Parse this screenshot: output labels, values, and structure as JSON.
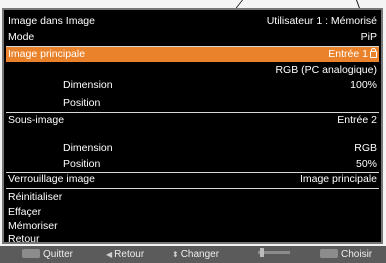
{
  "menu": {
    "title": "Image dans Image",
    "user_status": "Utilisateur 1 : Mémorisé",
    "mode_label": "Mode",
    "mode_value": "PiP",
    "main_image_label": "Image principale",
    "main_image_value": "Entrée 1",
    "main_image_signal": "RGB (PC analogique)",
    "main_dimension_label": "Dimension",
    "main_dimension_value": "100%",
    "main_position_label": "Position",
    "sub_image_label": "Sous-image",
    "sub_image_value": "Entrée 2",
    "sub_dimension_label": "Dimension",
    "sub_dimension_value": "RGB",
    "sub_position_label": "Position",
    "sub_position_value": "50%",
    "image_lock_label": "Verrouillage image",
    "image_lock_value": "Image principale",
    "reset_label": "Réinitialiser",
    "clear_label": "Effaçer",
    "store_label": "Mémoriser",
    "back_label": "Retour"
  },
  "footer": {
    "quit_label": "Quitter",
    "back_label": "Retour",
    "change_label": "Changer",
    "choose_label": "Choisir"
  },
  "colors": {
    "highlight": "#e9822a",
    "panel": "#000000",
    "footer": "#5b5b5b"
  }
}
